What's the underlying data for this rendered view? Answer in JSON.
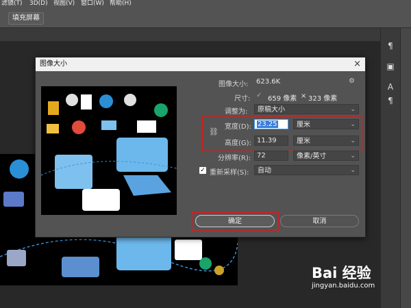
{
  "menu": {
    "items": [
      "滤镜(T)",
      "3D(D)",
      "视图(V)",
      "窗口(W)",
      "帮助(H)"
    ]
  },
  "options_bar": {
    "fill_screen_label": "填充屏幕"
  },
  "dialog": {
    "title": "图像大小",
    "close_glyph": "×",
    "image_size_label": "图像大小:",
    "image_size_value": "623.6K",
    "gear_glyph": "⚙",
    "dimensions_label": "尺寸:",
    "dimensions_width": "659 像素",
    "dimensions_times": "×",
    "dimensions_height": "323 像素",
    "fit_to_label": "调整为:",
    "fit_to_value": "原稿大小",
    "width_label": "宽度(D):",
    "width_value": "23.25",
    "width_unit": "厘米",
    "height_label": "高度(G):",
    "height_value": "11.39",
    "height_unit": "厘米",
    "resolution_label": "分辨率(R):",
    "resolution_value": "72",
    "resolution_unit": "像素/英寸",
    "resample_label": "重新采样(S):",
    "resample_checked": true,
    "resample_value": "自动",
    "ok_label": "确定",
    "cancel_label": "取消",
    "highlight_color": "#d21f1f"
  },
  "right_panel": {
    "icons": [
      "paragraph-text-icon",
      "type-tool-icon",
      "paragraph-icon"
    ]
  },
  "watermark": {
    "brand": "Bai 经验",
    "url": "jingyan.baidu.com"
  }
}
